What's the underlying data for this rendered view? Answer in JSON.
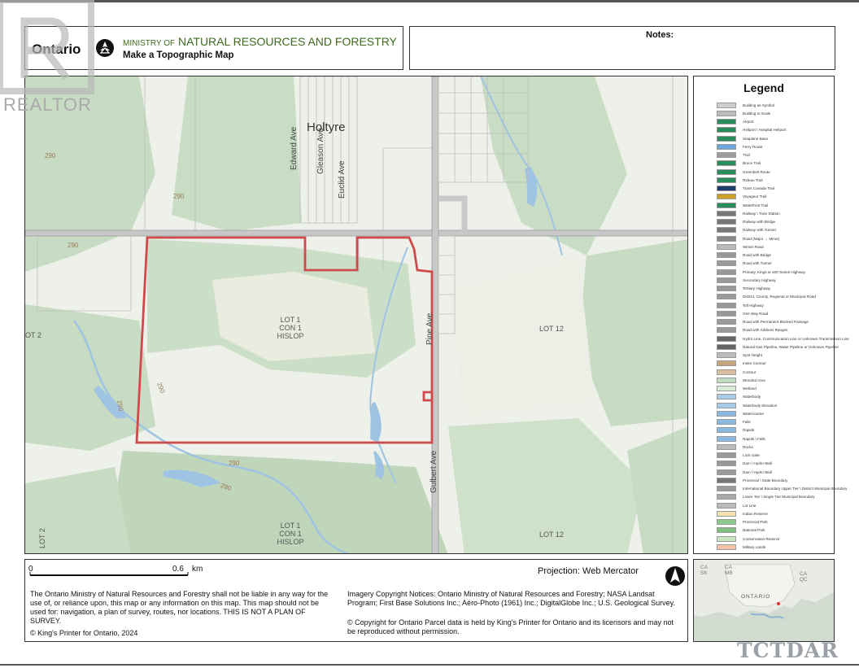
{
  "header": {
    "brand": "Ontario",
    "ministry_prefix": "MINISTRY OF",
    "ministry_name": "NATURAL RESOURCES AND FORESTRY",
    "subtitle": "Make a Topographic Map"
  },
  "notes": {
    "label": "Notes:"
  },
  "map": {
    "place_name": "Holtyre",
    "streets": [
      "Edward Ave",
      "Gleason Ave",
      "Euclid Ave",
      "Pine Ave",
      "Gulbert Ave"
    ],
    "parcel_labels": [
      {
        "line1": "LOT 1",
        "line2": "CON 1",
        "line3": "HISLOP"
      },
      {
        "line1": "LOT 1",
        "line2": "CON 1",
        "line3": "HISLOP"
      }
    ],
    "lot_labels": [
      "LOT 12",
      "LOT 12",
      "OT 2",
      "LOT 2"
    ],
    "contours": [
      "290",
      "290",
      "290",
      "290",
      "290",
      "290",
      "280"
    ]
  },
  "legend": {
    "title": "Legend",
    "items": [
      {
        "label": "Building as Symbol",
        "color": "#cfcfcf"
      },
      {
        "label": "Building to Scale",
        "color": "#bdbdbd"
      },
      {
        "label": "Airport",
        "color": "#2a8c5a"
      },
      {
        "label": "Heliport \\ Hospital Heliport",
        "color": "#2a8c5a"
      },
      {
        "label": "Seaplane Base",
        "color": "#2a8c5a"
      },
      {
        "label": "Ferry Route",
        "color": "#6fa8dc"
      },
      {
        "label": "Trail",
        "color": "#9e9e9e"
      },
      {
        "label": "Bruce Trail",
        "color": "#2a8c5a"
      },
      {
        "label": "Greenbelt Route",
        "color": "#2a8c5a"
      },
      {
        "label": "Rideau Trail",
        "color": "#2a8c5a"
      },
      {
        "label": "Trans Canada Trail",
        "color": "#1d3b6d"
      },
      {
        "label": "Voyageur Trail",
        "color": "#c9a227"
      },
      {
        "label": "Waterfront Trail",
        "color": "#2a8c5a"
      },
      {
        "label": "Railway \\ Train Station",
        "color": "#777777"
      },
      {
        "label": "Railway with Bridge",
        "color": "#777777"
      },
      {
        "label": "Railway with Tunnel",
        "color": "#777777"
      },
      {
        "label": "Road (Major → Minor)",
        "color": "#888888"
      },
      {
        "label": "Winter Road",
        "color": "#bbbbbb"
      },
      {
        "label": "Road with Bridge",
        "color": "#999999"
      },
      {
        "label": "Road with Tunnel",
        "color": "#999999"
      },
      {
        "label": "Primary, Kings or 400 Series Highway",
        "color": "#999999"
      },
      {
        "label": "Secondary Highway",
        "color": "#999999"
      },
      {
        "label": "Tertiary Highway",
        "color": "#999999"
      },
      {
        "label": "District, County, Regional or Municipal Road",
        "color": "#999999"
      },
      {
        "label": "Toll Highway",
        "color": "#999999"
      },
      {
        "label": "One Way Road",
        "color": "#999999"
      },
      {
        "label": "Road with Permanent Blocked Passage",
        "color": "#999999"
      },
      {
        "label": "Road with Address Ranges",
        "color": "#999999"
      },
      {
        "label": "Hydro Line, Communication Line or Unknown Transmission Line",
        "color": "#666666"
      },
      {
        "label": "Natural Gas Pipeline, Water Pipeline or Unknown Pipeline",
        "color": "#666666"
      },
      {
        "label": "Spot Height",
        "color": "#bbbbbb"
      },
      {
        "label": "Index Contour",
        "color": "#c9a57a"
      },
      {
        "label": "Contour",
        "color": "#d9bf9f"
      },
      {
        "label": "Wooded Area",
        "color": "#bfdcc0"
      },
      {
        "label": "Wetland",
        "color": "#d6ecd6"
      },
      {
        "label": "Waterbody",
        "color": "#a8cbe8"
      },
      {
        "label": "Waterbody Elevation",
        "color": "#a8cbe8"
      },
      {
        "label": "Watercourse",
        "color": "#8bb8e0"
      },
      {
        "label": "Falls",
        "color": "#8bb8e0"
      },
      {
        "label": "Rapids",
        "color": "#8bb8e0"
      },
      {
        "label": "Rapids \\ Falls",
        "color": "#8bb8e0"
      },
      {
        "label": "Rocks",
        "color": "#bbbbbb"
      },
      {
        "label": "Lock Gate",
        "color": "#999999"
      },
      {
        "label": "Dam \\ Hydro Wall",
        "color": "#999999"
      },
      {
        "label": "Dam \\ Hydro Wall",
        "color": "#999999"
      },
      {
        "label": "Provincial \\ State Boundary",
        "color": "#777777"
      },
      {
        "label": "International Boundary Upper Tier \\ District Municipal Boundary",
        "color": "#999999"
      },
      {
        "label": "Lower Tier \\ Single Tier Municipal Boundary",
        "color": "#aaaaaa"
      },
      {
        "label": "Lot Line",
        "color": "#bbbbbb"
      },
      {
        "label": "Indian Reserve",
        "color": "#f3e3b0"
      },
      {
        "label": "Provincial Park",
        "color": "#8cc98c"
      },
      {
        "label": "National Park",
        "color": "#7fbf7f"
      },
      {
        "label": "Conservation Reserve",
        "color": "#c9e6c1"
      },
      {
        "label": "Military Lands",
        "color": "#f2c4a8"
      }
    ]
  },
  "scale": {
    "start": "0",
    "end": "0.6",
    "unit": "km"
  },
  "projection": "Projection: Web Mercator",
  "disclaimer": "The Ontario Ministry of Natural Resources and Forestry shall not be liable in any way for the use of, or reliance upon, this map or any information on this map.  This map should not be used for: navigation, a plan of survey, routes, nor locations. THIS IS NOT A PLAN OF SURVEY.",
  "copyright_kings": "© King's Printer for Ontario,  2024",
  "imagery_notice": "Imagery Copyright Notices: Ontario Ministry of Natural Resources and Forestry; NASA Landsat Program; First Base Solutions Inc.; Aéro-Photo (1961) Inc.; DigitalGlobe Inc.; U.S. Geological Survey.",
  "parcel_notice": "© Copyright for Ontario Parcel data is held by King's Printer for Ontario and its licensors and may not be reproduced without permission.",
  "inset": {
    "labels": [
      "CA",
      "SK",
      "CA",
      "MB",
      "CA",
      "QC",
      "ONTARIO"
    ]
  },
  "watermark": {
    "text": "REALTOR"
  },
  "brand_mark": {
    "text": "TCTDAR"
  }
}
